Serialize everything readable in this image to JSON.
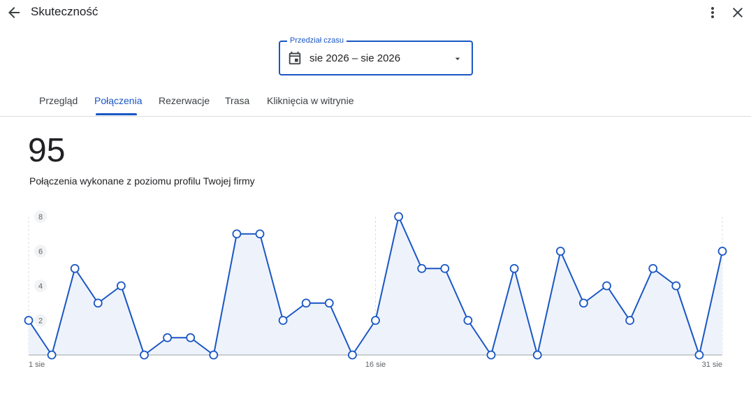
{
  "header": {
    "title": "Skuteczność"
  },
  "range_select": {
    "label": "Przedział czasu",
    "value": "sie 2026 – sie 2026"
  },
  "tabs": [
    {
      "label": "Przegląd",
      "active": false
    },
    {
      "label": "Połączenia",
      "active": true
    },
    {
      "label": "Rezerwacje",
      "active": false
    },
    {
      "label": "Trasa",
      "active": false
    },
    {
      "label": "Kliknięcia w witrynie",
      "active": false
    }
  ],
  "metric": {
    "value": "95",
    "description": "Połączenia wykonane z poziomu profilu Twojej firmy"
  },
  "colors": {
    "accent": "#1a56c4",
    "line": "#1a56c4",
    "area_fill": "#eef3fb"
  },
  "chart_data": {
    "type": "area",
    "x": [
      1,
      2,
      3,
      4,
      5,
      6,
      7,
      8,
      9,
      10,
      11,
      12,
      13,
      14,
      15,
      16,
      17,
      18,
      19,
      20,
      21,
      22,
      23,
      24,
      25,
      26,
      27,
      28,
      29,
      30,
      31
    ],
    "values": [
      2,
      0,
      5,
      3,
      4,
      0,
      1,
      1,
      0,
      7,
      7,
      2,
      3,
      3,
      0,
      2,
      8,
      5,
      5,
      2,
      0,
      5,
      0,
      6,
      3,
      4,
      2,
      5,
      4,
      0,
      6
    ],
    "y_ticks": [
      "2",
      "4",
      "6",
      "8"
    ],
    "x_tick_labels": [
      {
        "x": 1,
        "label": "1 sie"
      },
      {
        "x": 16,
        "label": "16 sie"
      },
      {
        "x": 31,
        "label": "31 sie"
      }
    ],
    "ylim": [
      0,
      8
    ],
    "grid": "dashed vertical lines at labeled dates"
  }
}
